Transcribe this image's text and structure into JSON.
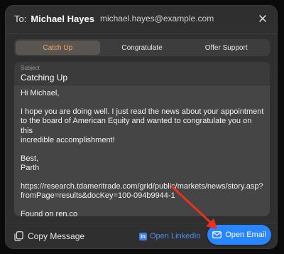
{
  "header": {
    "to_label": "To:",
    "recipient_name": "Michael Hayes",
    "recipient_email": "michael.hayes@example.com"
  },
  "tabs": [
    {
      "label": "Catch Up",
      "active": true
    },
    {
      "label": "Congratulate",
      "active": false
    },
    {
      "label": "Offer Support",
      "active": false
    }
  ],
  "subject": {
    "label": "Subject",
    "value": "Catching Up"
  },
  "message": {
    "greeting": "Hi Michael,",
    "line1": "I hope you are doing well. I just read the news about your appointment",
    "line2": "to the board of American Equity and wanted to congratulate you on this",
    "line3": "incredible accomplishment!",
    "signoff": "Best,",
    "signature": "Parth",
    "url_line1": "https://research.tdameritrade.com/grid/public/markets/news/story.asp?",
    "url_line2": "fromPage=results&docKey=100-094b9944-1",
    "source": "Found on ren.co"
  },
  "footer": {
    "copy_label": "Copy Message",
    "linkedin_label": "Open LinkedIn",
    "open_email_label": "Open Email"
  },
  "colors": {
    "accent": "#2a86ff",
    "active_tab_text": "#f0a860",
    "linkedin": "#4a8df0",
    "annotation_arrow": "#e8321e"
  },
  "icons": {
    "close": "close-icon",
    "copy": "copy-icon",
    "linkedin": "linkedin-icon",
    "mail": "mail-icon"
  }
}
